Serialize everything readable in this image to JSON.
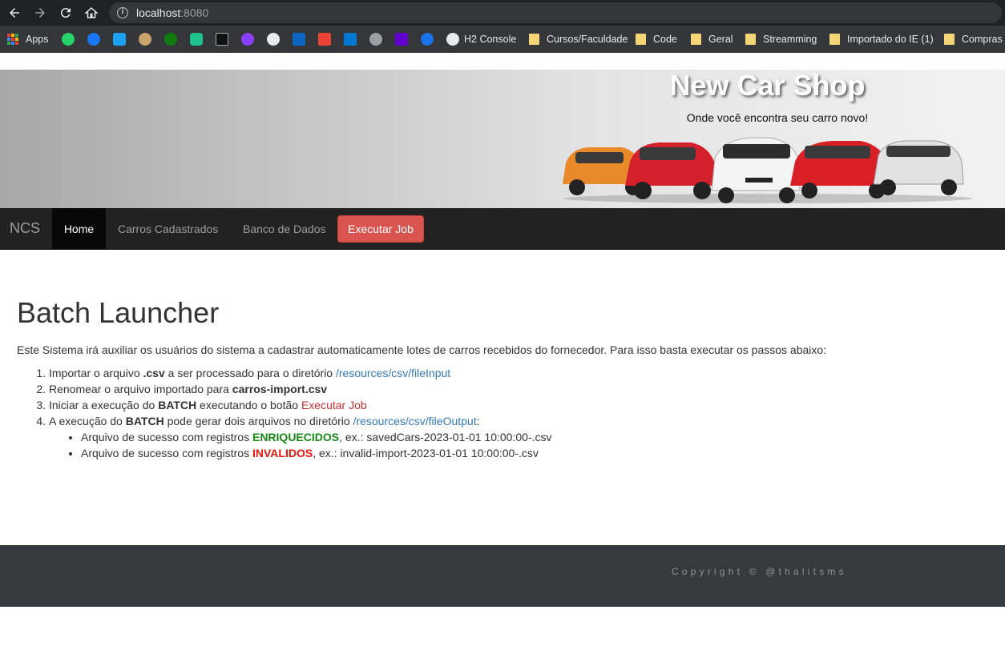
{
  "browser": {
    "url_host": "localhost",
    "url_port": ":8080",
    "bookmarks": [
      {
        "label": "Apps"
      },
      {
        "label": "H2 Console"
      },
      {
        "label": "Cursos/Faculdade"
      },
      {
        "label": "Code"
      },
      {
        "label": "Geral"
      },
      {
        "label": "Streamming"
      },
      {
        "label": "Importado do IE (1)"
      },
      {
        "label": "Compras"
      }
    ]
  },
  "banner": {
    "title": "New Car Shop",
    "subtitle": "Onde você encontra seu carro novo!"
  },
  "navbar": {
    "brand": "NCS",
    "home": "Home",
    "cars": "Carros Cadastrados",
    "database": "Banco de Dados",
    "run_job": "Executar Job"
  },
  "main": {
    "heading": "Batch Launcher",
    "intro": "Este Sistema irá auxiliar os usuários do sistema a cadastrar automaticamente lotes de carros recebidos do fornecedor. Para isso basta executar os passos abaixo:",
    "step1": {
      "a": "Importar o arquivo ",
      "b": ".csv",
      "c": " a ser processado para o diretório ",
      "link": "/resources/csv/fileInput"
    },
    "step2": {
      "a": "Renomear o arquivo importado para ",
      "b": "carros-import.csv"
    },
    "step3": {
      "a": "Iniciar a execução do ",
      "b": "BATCH",
      "c": " executando o botão ",
      "link": "Executar Job"
    },
    "step4": {
      "a": "A execução do ",
      "b": "BATCH",
      "c": " pode gerar dois arquivos no diretório ",
      "link": "/resources/csv/fileOutput",
      "d": ":"
    },
    "sub1": {
      "a": "Arquivo de sucesso com registros ",
      "b": "ENRIQUECIDOS",
      "c": ", ex.: savedCars-2023-01-01 10:00:00-.csv"
    },
    "sub2": {
      "a": "Arquivo de sucesso com registros ",
      "b": "INVALIDOS",
      "c": ", ex.: invalid-import-2023-01-01 10:00:00-.csv"
    }
  },
  "footer": {
    "copyright": "Copyright © @thalitsms"
  },
  "colors": {
    "navbar_bg": "#222222",
    "job_button": "#d9534f",
    "footer_bg": "#343a40",
    "link": "#337ab7"
  }
}
